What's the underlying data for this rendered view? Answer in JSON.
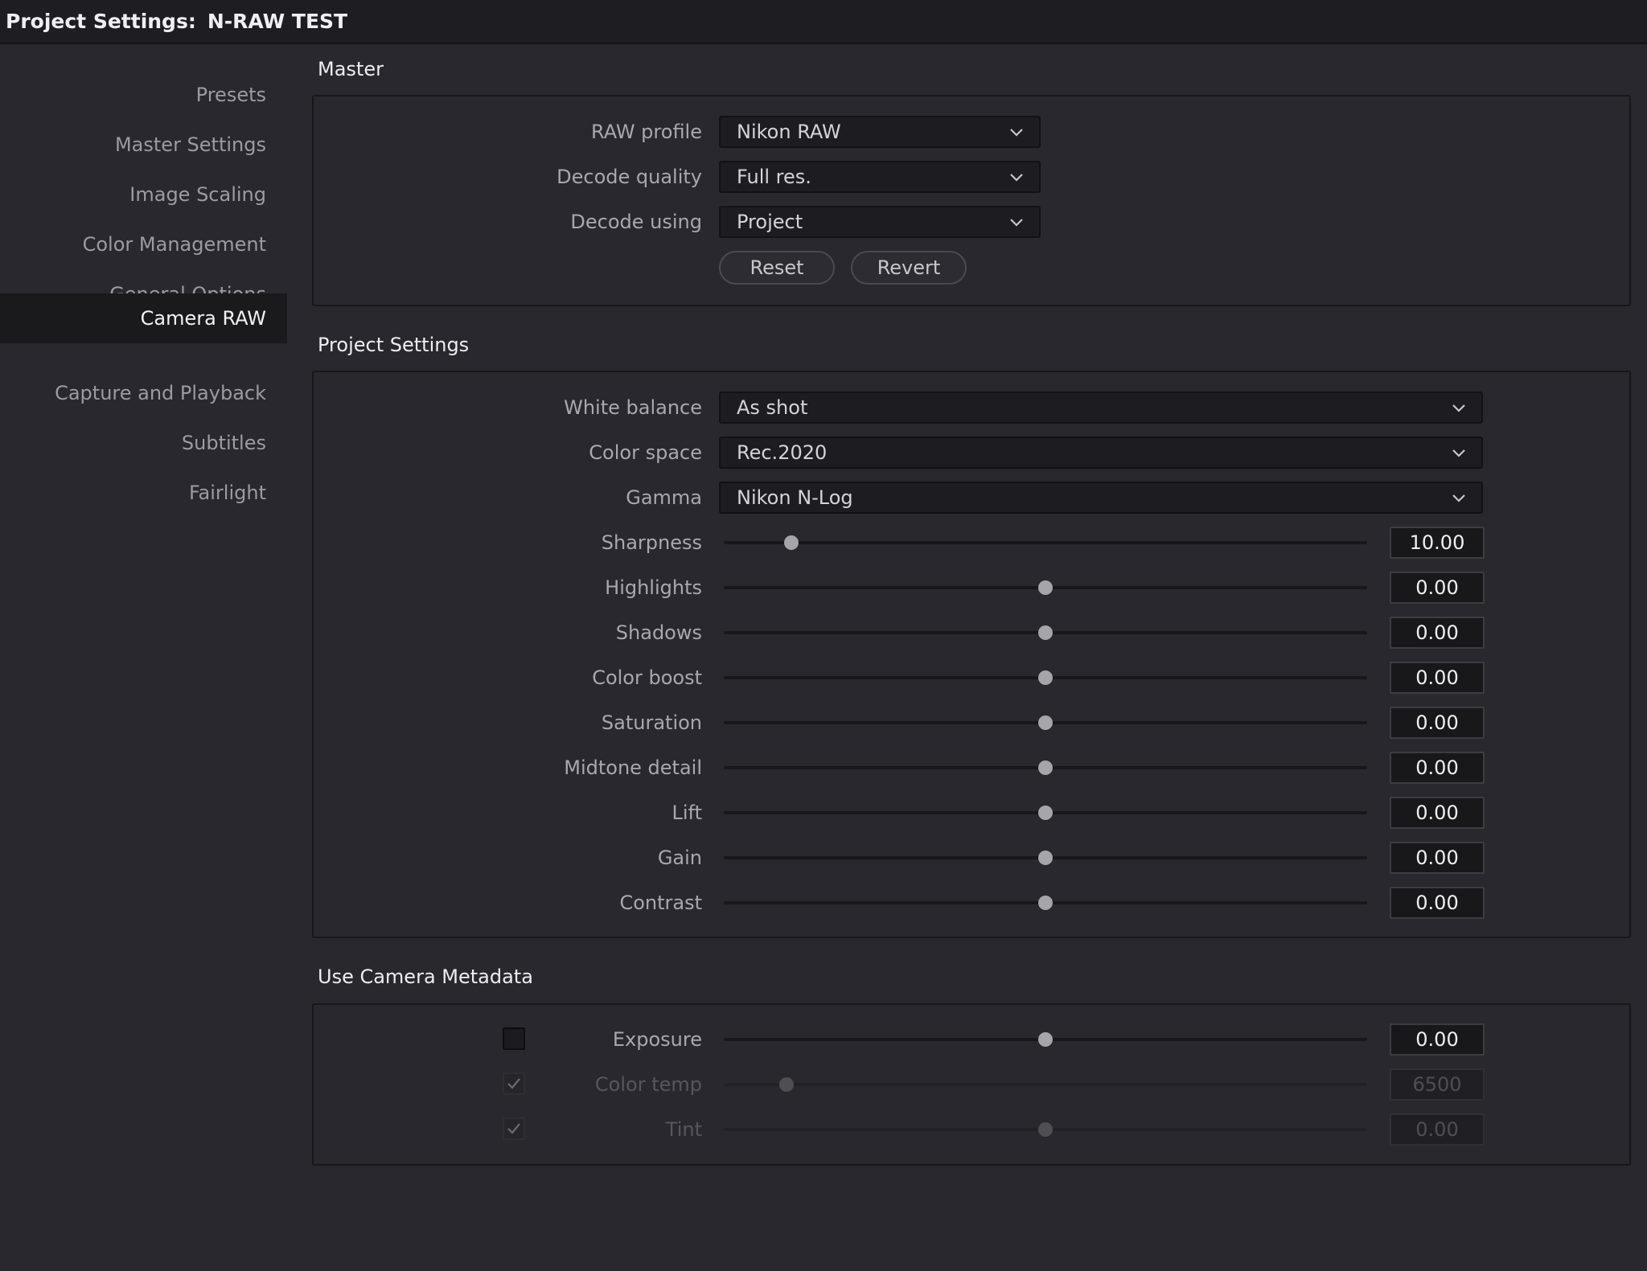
{
  "window": {
    "title_prefix": "Project Settings:",
    "project_name": "N-RAW TEST"
  },
  "sidebar": {
    "active": "Camera RAW",
    "items": [
      {
        "label": "Presets"
      },
      {
        "label": "Master Settings"
      },
      {
        "label": "Image Scaling"
      },
      {
        "label": "Color Management"
      },
      {
        "label": "General Options"
      },
      {
        "label": "Camera RAW"
      },
      {
        "label": "Capture and Playback"
      },
      {
        "label": "Subtitles"
      },
      {
        "label": "Fairlight"
      }
    ]
  },
  "master": {
    "title": "Master",
    "raw_profile": {
      "label": "RAW profile",
      "value": "Nikon RAW"
    },
    "decode_quality": {
      "label": "Decode quality",
      "value": "Full res."
    },
    "decode_using": {
      "label": "Decode using",
      "value": "Project"
    },
    "reset_label": "Reset",
    "revert_label": "Revert"
  },
  "project_settings": {
    "title": "Project Settings",
    "white_balance": {
      "label": "White balance",
      "value": "As shot"
    },
    "color_space": {
      "label": "Color space",
      "value": "Rec.2020"
    },
    "gamma": {
      "label": "Gamma",
      "value": "Nikon N-Log"
    },
    "sliders": [
      {
        "label": "Sharpness",
        "value": "10.00",
        "position": 0.105
      },
      {
        "label": "Highlights",
        "value": "0.00",
        "position": 0.5
      },
      {
        "label": "Shadows",
        "value": "0.00",
        "position": 0.5
      },
      {
        "label": "Color boost",
        "value": "0.00",
        "position": 0.5
      },
      {
        "label": "Saturation",
        "value": "0.00",
        "position": 0.5
      },
      {
        "label": "Midtone detail",
        "value": "0.00",
        "position": 0.5
      },
      {
        "label": "Lift",
        "value": "0.00",
        "position": 0.5
      },
      {
        "label": "Gain",
        "value": "0.00",
        "position": 0.5
      },
      {
        "label": "Contrast",
        "value": "0.00",
        "position": 0.5
      }
    ]
  },
  "camera_metadata": {
    "title": "Use Camera Metadata",
    "rows": [
      {
        "label": "Exposure",
        "value": "0.00",
        "checked": false,
        "enabled": true,
        "position": 0.5
      },
      {
        "label": "Color temp",
        "value": "6500",
        "checked": true,
        "enabled": false,
        "position": 0.097
      },
      {
        "label": "Tint",
        "value": "0.00",
        "checked": true,
        "enabled": false,
        "position": 0.5
      }
    ]
  },
  "icons": {
    "dropdown": "chevron-down-icon",
    "checkbox_mark": "checkmark-icon"
  },
  "colors": {
    "background": "#28282e",
    "titlebar": "#1e1e22",
    "active_nav": "#1a1a1d",
    "field": "#1d1d21",
    "knob": "#a6a6aa"
  }
}
